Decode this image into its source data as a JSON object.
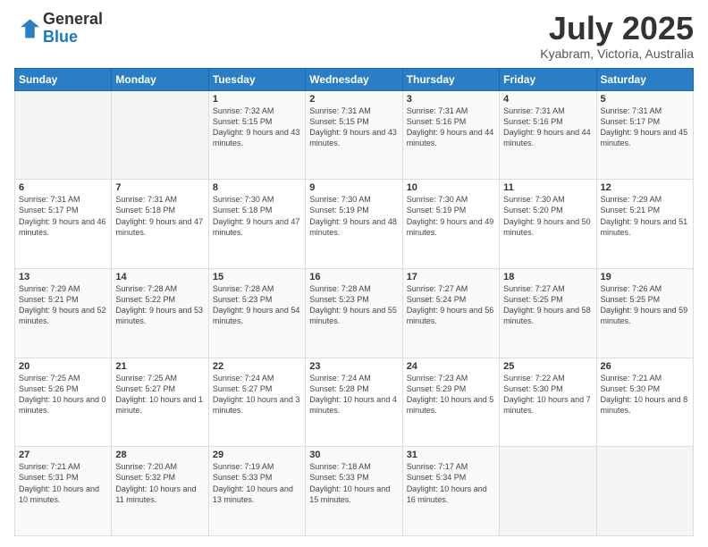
{
  "header": {
    "logo_general": "General",
    "logo_blue": "Blue",
    "month": "July 2025",
    "location": "Kyabram, Victoria, Australia"
  },
  "days_of_week": [
    "Sunday",
    "Monday",
    "Tuesday",
    "Wednesday",
    "Thursday",
    "Friday",
    "Saturday"
  ],
  "weeks": [
    [
      {
        "day": "",
        "info": ""
      },
      {
        "day": "",
        "info": ""
      },
      {
        "day": "1",
        "info": "Sunrise: 7:32 AM\nSunset: 5:15 PM\nDaylight: 9 hours and 43 minutes."
      },
      {
        "day": "2",
        "info": "Sunrise: 7:31 AM\nSunset: 5:15 PM\nDaylight: 9 hours and 43 minutes."
      },
      {
        "day": "3",
        "info": "Sunrise: 7:31 AM\nSunset: 5:16 PM\nDaylight: 9 hours and 44 minutes."
      },
      {
        "day": "4",
        "info": "Sunrise: 7:31 AM\nSunset: 5:16 PM\nDaylight: 9 hours and 44 minutes."
      },
      {
        "day": "5",
        "info": "Sunrise: 7:31 AM\nSunset: 5:17 PM\nDaylight: 9 hours and 45 minutes."
      }
    ],
    [
      {
        "day": "6",
        "info": "Sunrise: 7:31 AM\nSunset: 5:17 PM\nDaylight: 9 hours and 46 minutes."
      },
      {
        "day": "7",
        "info": "Sunrise: 7:31 AM\nSunset: 5:18 PM\nDaylight: 9 hours and 47 minutes."
      },
      {
        "day": "8",
        "info": "Sunrise: 7:30 AM\nSunset: 5:18 PM\nDaylight: 9 hours and 47 minutes."
      },
      {
        "day": "9",
        "info": "Sunrise: 7:30 AM\nSunset: 5:19 PM\nDaylight: 9 hours and 48 minutes."
      },
      {
        "day": "10",
        "info": "Sunrise: 7:30 AM\nSunset: 5:19 PM\nDaylight: 9 hours and 49 minutes."
      },
      {
        "day": "11",
        "info": "Sunrise: 7:30 AM\nSunset: 5:20 PM\nDaylight: 9 hours and 50 minutes."
      },
      {
        "day": "12",
        "info": "Sunrise: 7:29 AM\nSunset: 5:21 PM\nDaylight: 9 hours and 51 minutes."
      }
    ],
    [
      {
        "day": "13",
        "info": "Sunrise: 7:29 AM\nSunset: 5:21 PM\nDaylight: 9 hours and 52 minutes."
      },
      {
        "day": "14",
        "info": "Sunrise: 7:28 AM\nSunset: 5:22 PM\nDaylight: 9 hours and 53 minutes."
      },
      {
        "day": "15",
        "info": "Sunrise: 7:28 AM\nSunset: 5:23 PM\nDaylight: 9 hours and 54 minutes."
      },
      {
        "day": "16",
        "info": "Sunrise: 7:28 AM\nSunset: 5:23 PM\nDaylight: 9 hours and 55 minutes."
      },
      {
        "day": "17",
        "info": "Sunrise: 7:27 AM\nSunset: 5:24 PM\nDaylight: 9 hours and 56 minutes."
      },
      {
        "day": "18",
        "info": "Sunrise: 7:27 AM\nSunset: 5:25 PM\nDaylight: 9 hours and 58 minutes."
      },
      {
        "day": "19",
        "info": "Sunrise: 7:26 AM\nSunset: 5:25 PM\nDaylight: 9 hours and 59 minutes."
      }
    ],
    [
      {
        "day": "20",
        "info": "Sunrise: 7:25 AM\nSunset: 5:26 PM\nDaylight: 10 hours and 0 minutes."
      },
      {
        "day": "21",
        "info": "Sunrise: 7:25 AM\nSunset: 5:27 PM\nDaylight: 10 hours and 1 minute."
      },
      {
        "day": "22",
        "info": "Sunrise: 7:24 AM\nSunset: 5:27 PM\nDaylight: 10 hours and 3 minutes."
      },
      {
        "day": "23",
        "info": "Sunrise: 7:24 AM\nSunset: 5:28 PM\nDaylight: 10 hours and 4 minutes."
      },
      {
        "day": "24",
        "info": "Sunrise: 7:23 AM\nSunset: 5:29 PM\nDaylight: 10 hours and 5 minutes."
      },
      {
        "day": "25",
        "info": "Sunrise: 7:22 AM\nSunset: 5:30 PM\nDaylight: 10 hours and 7 minutes."
      },
      {
        "day": "26",
        "info": "Sunrise: 7:21 AM\nSunset: 5:30 PM\nDaylight: 10 hours and 8 minutes."
      }
    ],
    [
      {
        "day": "27",
        "info": "Sunrise: 7:21 AM\nSunset: 5:31 PM\nDaylight: 10 hours and 10 minutes."
      },
      {
        "day": "28",
        "info": "Sunrise: 7:20 AM\nSunset: 5:32 PM\nDaylight: 10 hours and 11 minutes."
      },
      {
        "day": "29",
        "info": "Sunrise: 7:19 AM\nSunset: 5:33 PM\nDaylight: 10 hours and 13 minutes."
      },
      {
        "day": "30",
        "info": "Sunrise: 7:18 AM\nSunset: 5:33 PM\nDaylight: 10 hours and 15 minutes."
      },
      {
        "day": "31",
        "info": "Sunrise: 7:17 AM\nSunset: 5:34 PM\nDaylight: 10 hours and 16 minutes."
      },
      {
        "day": "",
        "info": ""
      },
      {
        "day": "",
        "info": ""
      }
    ]
  ]
}
